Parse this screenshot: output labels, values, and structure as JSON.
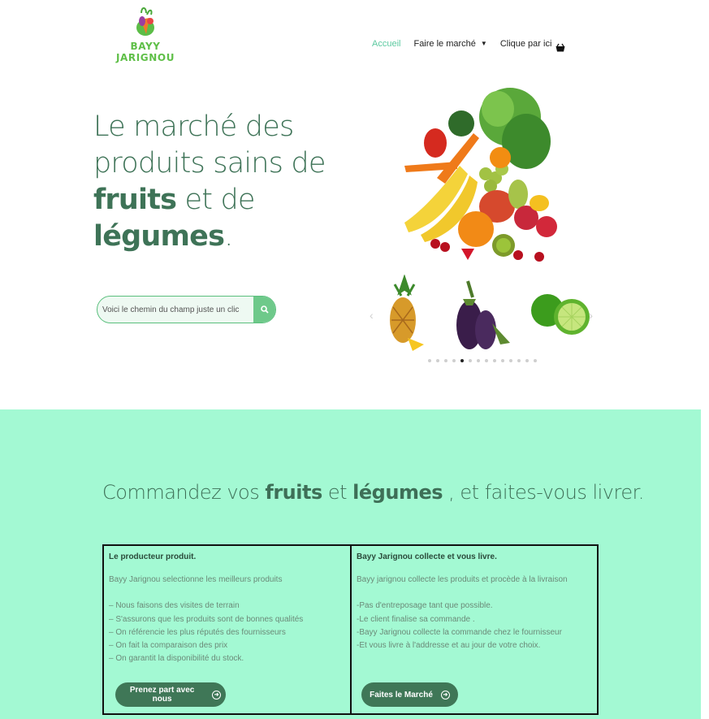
{
  "header": {
    "logo_text": "BAYY JARIGNOU",
    "nav": [
      {
        "label": "Accueil"
      },
      {
        "label": "Faire le marché"
      },
      {
        "label": "Clique par ici"
      }
    ],
    "cart_icon": "shopping-basket-icon"
  },
  "hero": {
    "title_line1": "Le marché des",
    "title_line2": "produits sains de",
    "title_bold1": "fruits",
    "title_mid": " et de ",
    "title_bold2": "légumes",
    "title_end": ".",
    "search_placeholder": "Voici le chemin du champ juste un clic",
    "carousel": {
      "slides": [
        "pineapple",
        "eggplant",
        "lime"
      ],
      "dot_count": 14,
      "active_dot": 4
    }
  },
  "section2": {
    "title_part1": "Commandez vos ",
    "title_bold1": "fruits",
    "title_part2": " et ",
    "title_bold2": "légumes",
    "title_part3": " , et faites-vous livrer.",
    "left": {
      "heading": "Le producteur produit.",
      "lead": "Bayy Jarignou selectionne les meilleurs produits",
      "items": [
        "– Nous faisons des visites de terrain",
        "– S'assurons que les produits sont de bonnes qualités",
        "– On référencie les plus réputés des fournisseurs",
        "– On fait la comparaison des prix",
        "– On garantit la disponibilité du stock."
      ],
      "button": "Prenez part avec nous"
    },
    "right": {
      "heading": "Bayy Jarignou collecte et vous livre.",
      "lead": "Bayy jarignou collecte les produits et procède à la livraison",
      "items": [
        "-Pas d'entreposage tant que possible.",
        "-Le client finalise sa commande .",
        "-Bayy Jarignou collecte la commande chez le fournisseur",
        "-Et vous livre à l'addresse et au jour de votre choix."
      ],
      "button": "Faites le Marché"
    }
  },
  "colors": {
    "brand_green": "#3e7357",
    "accent_mint": "#a3f9d3",
    "nav_active": "#5cc9a0"
  }
}
